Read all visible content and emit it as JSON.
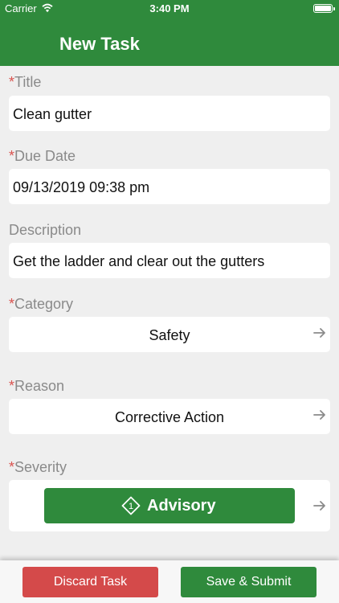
{
  "status_bar": {
    "carrier": "Carrier",
    "time": "3:40 PM"
  },
  "nav": {
    "title": "New Task"
  },
  "required_marker": "*",
  "form": {
    "title": {
      "label": "Title",
      "value": "Clean gutter"
    },
    "due_date": {
      "label": "Due Date",
      "value": "09/13/2019 09:38 pm"
    },
    "description": {
      "label": "Description",
      "value": "Get the ladder and clear out the gutters"
    },
    "category": {
      "label": "Category",
      "value": "Safety"
    },
    "reason": {
      "label": "Reason",
      "value": "Corrective Action"
    },
    "severity": {
      "label": "Severity",
      "value": "Advisory",
      "icon_number": "1"
    }
  },
  "footer": {
    "discard_label": "Discard Task",
    "save_label": "Save & Submit"
  },
  "colors": {
    "brand_green": "#2f8a3c",
    "discard_red": "#d44a4a",
    "required_red": "#d9534f"
  }
}
